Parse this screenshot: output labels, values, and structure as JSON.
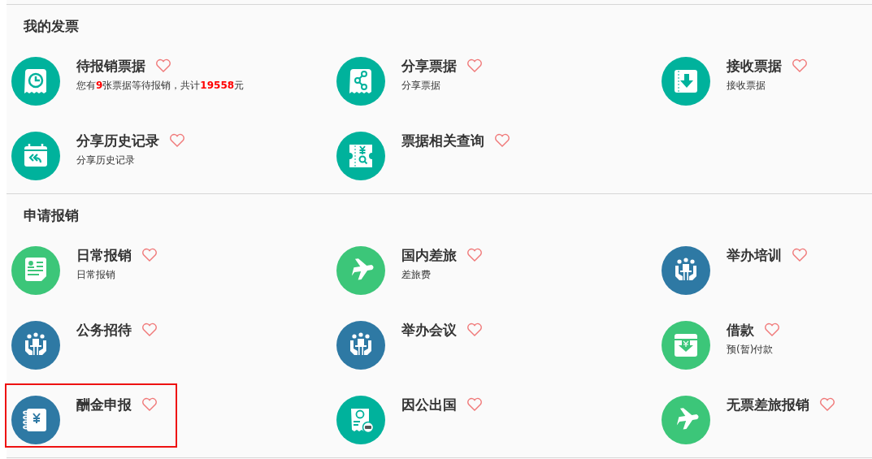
{
  "sections": [
    {
      "title": "我的发票",
      "items": [
        {
          "title": "待报销票据",
          "subtitle": "您有**9**张票据等待报销，共计**19558**元",
          "kind": "receipt-clock",
          "color": "#00b29c",
          "favorite": false,
          "highlighted": false
        },
        {
          "title": "分享票据",
          "subtitle": "分享票据",
          "kind": "receipt-share",
          "color": "#00b29c",
          "favorite": false,
          "highlighted": false
        },
        {
          "title": "接收票据",
          "subtitle": "接收票据",
          "kind": "ticket-download",
          "color": "#00b29c",
          "favorite": false,
          "highlighted": false
        },
        {
          "title": "分享历史记录",
          "subtitle": "分享历史记录",
          "kind": "calendar-reply",
          "color": "#00b29c",
          "favorite": false,
          "highlighted": false
        },
        {
          "title": "票据相关查询",
          "kind": "ticket-search",
          "color": "#00b29c",
          "favorite": false,
          "highlighted": false
        }
      ]
    },
    {
      "title": "申请报销",
      "items": [
        {
          "title": "日常报销",
          "subtitle": "日常报销",
          "kind": "document",
          "color": "#3cc679",
          "favorite": false,
          "highlighted": false
        },
        {
          "title": "国内差旅",
          "subtitle": "差旅费",
          "kind": "plane",
          "color": "#3cc679",
          "favorite": false,
          "highlighted": false
        },
        {
          "title": "举办培训",
          "kind": "meeting",
          "color": "#2e79a4",
          "favorite": false,
          "highlighted": false
        },
        {
          "title": "公务招待",
          "kind": "meeting",
          "color": "#2e79a4",
          "favorite": false,
          "highlighted": false
        },
        {
          "title": "举办会议",
          "kind": "meeting",
          "color": "#2e79a4",
          "favorite": false,
          "highlighted": false
        },
        {
          "title": "借款",
          "subtitle": "预(暂)付款",
          "kind": "money-box",
          "color": "#3cc679",
          "favorite": false,
          "highlighted": false
        },
        {
          "title": "酬金申报",
          "kind": "notebook-yen",
          "color": "#2e79a4",
          "favorite": false,
          "highlighted": true
        },
        {
          "title": "因公出国",
          "kind": "document-car",
          "color": "#00b29c",
          "favorite": false,
          "highlighted": false
        },
        {
          "title": "无票差旅报销",
          "kind": "plane",
          "color": "#3cc679",
          "favorite": false,
          "highlighted": false
        }
      ]
    }
  ]
}
